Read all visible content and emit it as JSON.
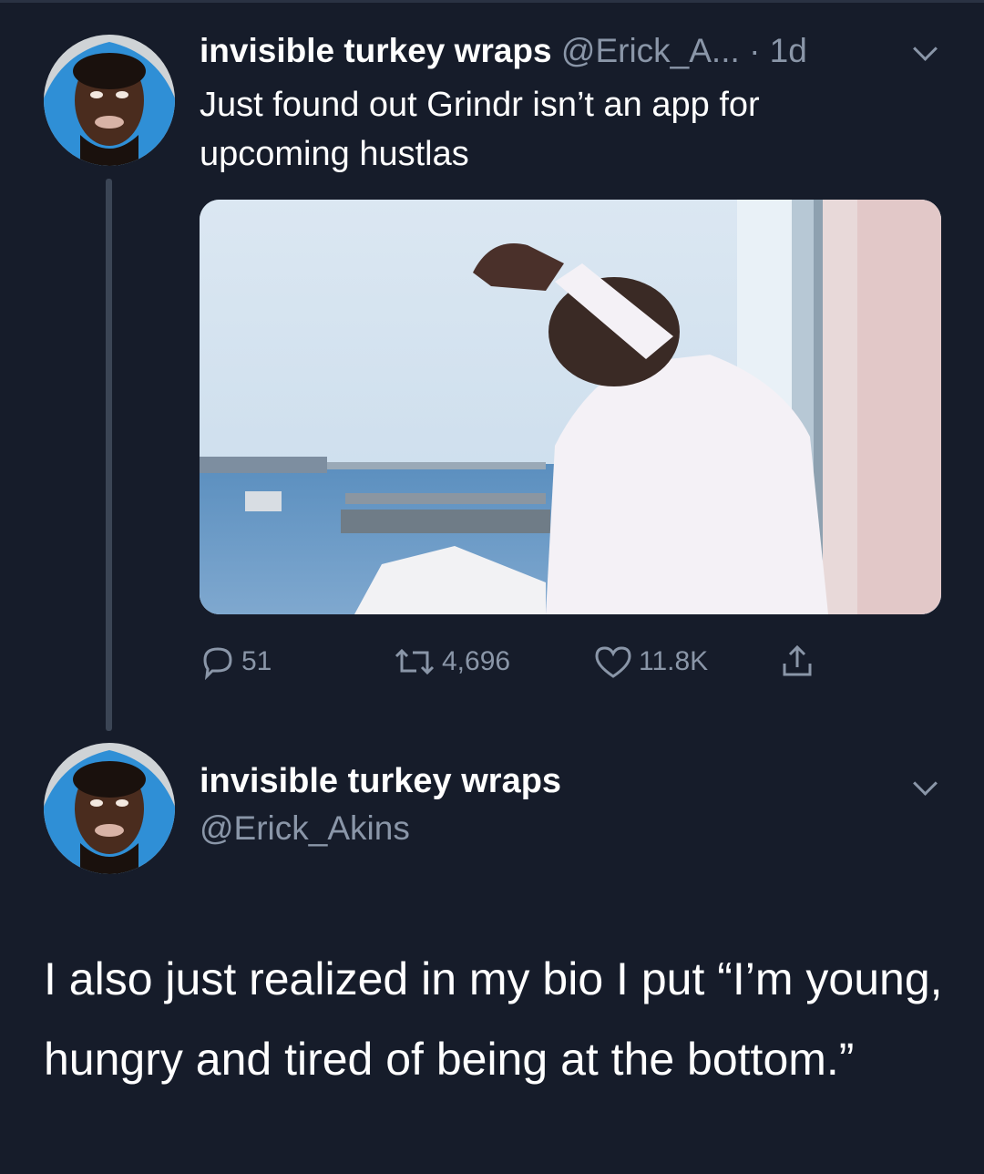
{
  "colors": {
    "background": "#161c2a",
    "text": "#ffffff",
    "muted": "#8a96a8",
    "thread_line": "#3b4555"
  },
  "tweet": {
    "display_name": "invisible turkey wraps",
    "handle_truncated": "@Erick_A...",
    "time": "· 1d",
    "text": "Just found out Grindr isn’t an app for upcoming hustlas",
    "media_description_icon": "photo",
    "actions": {
      "reply_icon": "reply-icon",
      "reply_count": "51",
      "retweet_icon": "retweet-icon",
      "retweet_count": "4,696",
      "like_icon": "heart-icon",
      "like_count": "11.8K",
      "share_icon": "share-icon"
    }
  },
  "reply": {
    "display_name": "invisible turkey wraps",
    "handle": "@Erick_Akins",
    "text": "I also just realized in my bio I put “I’m young, hungry and tired of being at the bottom.”"
  }
}
